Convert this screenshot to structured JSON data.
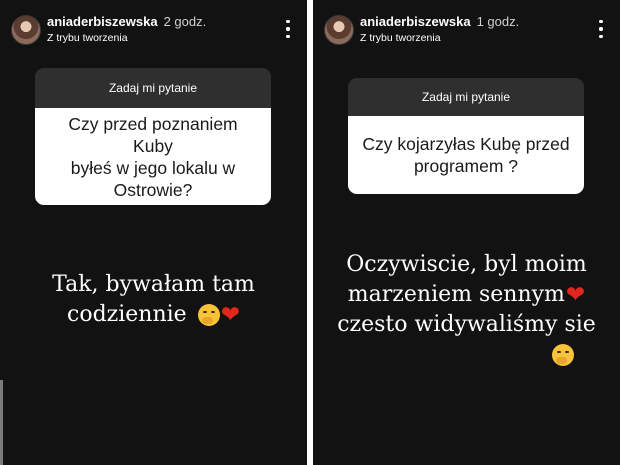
{
  "stories": [
    {
      "username": "aniaderbiszewska",
      "time": "2 godz.",
      "subtitle": "Z trybu tworzenia",
      "question_header": "Zadaj mi pytanie",
      "question_lines": [
        "Czy przed poznaniem Kuby",
        "byłeś w jego lokalu w",
        "Ostrowie?"
      ],
      "answer_lines": [
        "Tak, bywałam tam",
        "codziennie"
      ],
      "answer_emojis": [
        "shushing-face-emoji",
        "red-heart-emoji"
      ]
    },
    {
      "username": "aniaderbiszewska",
      "time": "1 godz.",
      "subtitle": "Z trybu tworzenia",
      "question_header": "Zadaj mi pytanie",
      "question_lines": [
        "Czy kojarzyłas Kubę przed",
        "programem ?"
      ],
      "answer_lines": [
        "Oczywiscie, byl moim",
        "marzeniem sennym",
        "czesto widywaliśmy sie"
      ],
      "answer_emojis": [
        "red-heart-emoji",
        "shushing-face-emoji"
      ]
    }
  ],
  "colors": {
    "story_background": "#121212",
    "question_header_bg": "#2f2f2f",
    "question_body_bg": "#ffffff",
    "heart": "#e0261d",
    "emoji_face": "#f7c33b"
  },
  "icons": {
    "more": "vertical-ellipsis-icon"
  }
}
